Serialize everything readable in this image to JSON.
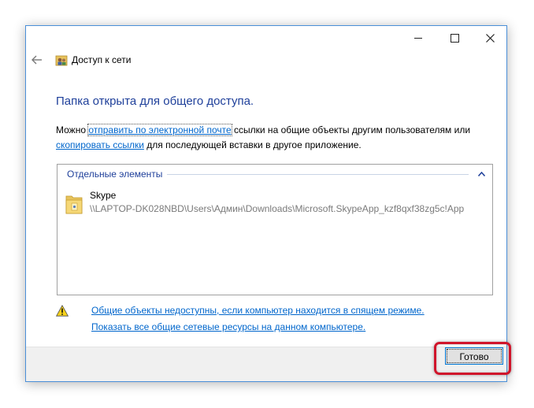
{
  "window": {
    "title": "Доступ к сети",
    "controls": {
      "minimize": "minimize",
      "maximize": "maximize",
      "close": "close"
    }
  },
  "main": {
    "heading": "Папка открыта для общего доступа.",
    "desc_prefix": "Можно ",
    "email_link": "отправить по электронной почте",
    "desc_middle": " ссылки на общие объекты другим пользователям или",
    "copy_link": "скопировать ссылки",
    "desc_suffix": " для последующей вставки в другое приложение."
  },
  "list": {
    "group_label": "Отдельные элементы",
    "items": [
      {
        "name": "Skype",
        "path": "\\\\LAPTOP-DK028NBD\\Users\\Админ\\Downloads\\Microsoft.SkypeApp_kzf8qxf38zg5c!App",
        "icon": "folder-icon"
      }
    ]
  },
  "links": {
    "sleep_warning": "Общие объекты недоступны, если компьютер находится в спящем режиме.",
    "show_shares": "Показать все общие сетевые ресурсы на данном компьютере."
  },
  "footer": {
    "done_label": "Готово"
  },
  "colors": {
    "heading": "#1e3f9a",
    "link": "#0066cc",
    "highlight": "#d0152b",
    "accent": "#0078d7"
  }
}
